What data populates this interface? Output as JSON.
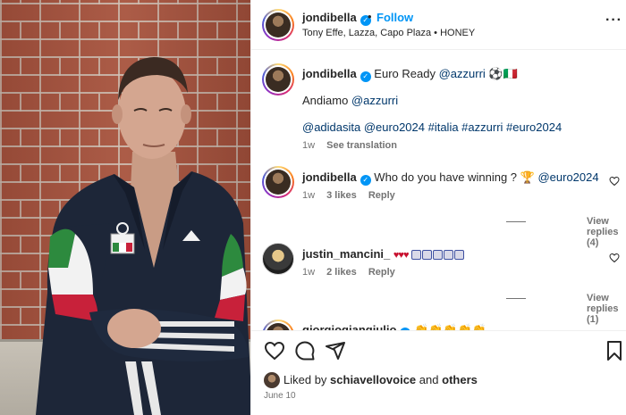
{
  "post": {
    "username": "jondibella",
    "follow_label": "Follow",
    "separator": "•",
    "audio_line": "Tony Effe, Lazza, Capo Plaza • HONEY",
    "more_label": "···"
  },
  "caption": {
    "username": "jondibella",
    "title_text": "Euro Ready",
    "title_mention": "@azzurri",
    "title_emoji": "⚽🇮🇹",
    "line2_text": "Andiamo",
    "line2_mention": "@azzurri",
    "hashtags": "@adidasita @euro2024 #italia #azzurri #euro2024",
    "time": "1w",
    "translate": "See translation"
  },
  "comments": [
    {
      "username": "jondibella",
      "text": "Who do you have winning ?",
      "emoji": "🏆",
      "mention": "@euro2024",
      "time": "1w",
      "likes": "3 likes",
      "reply": "Reply",
      "view_replies": "View replies (4)"
    },
    {
      "username": "justin_mancini_",
      "hearts": "♥♥♥",
      "time": "1w",
      "likes": "2 likes",
      "reply": "Reply",
      "view_replies": "View replies (1)"
    },
    {
      "username": "giorgiogiangiulio",
      "hands": "👏👏👏👏👏"
    }
  ],
  "footer": {
    "liked_prefix": "Liked by",
    "liked_user": "schiavellovoice",
    "liked_and": "and",
    "liked_others": "others",
    "date": "June 10"
  },
  "colors": {
    "accent": "#0095f6",
    "text": "#262626",
    "muted": "#737373",
    "link": "#00376b"
  }
}
